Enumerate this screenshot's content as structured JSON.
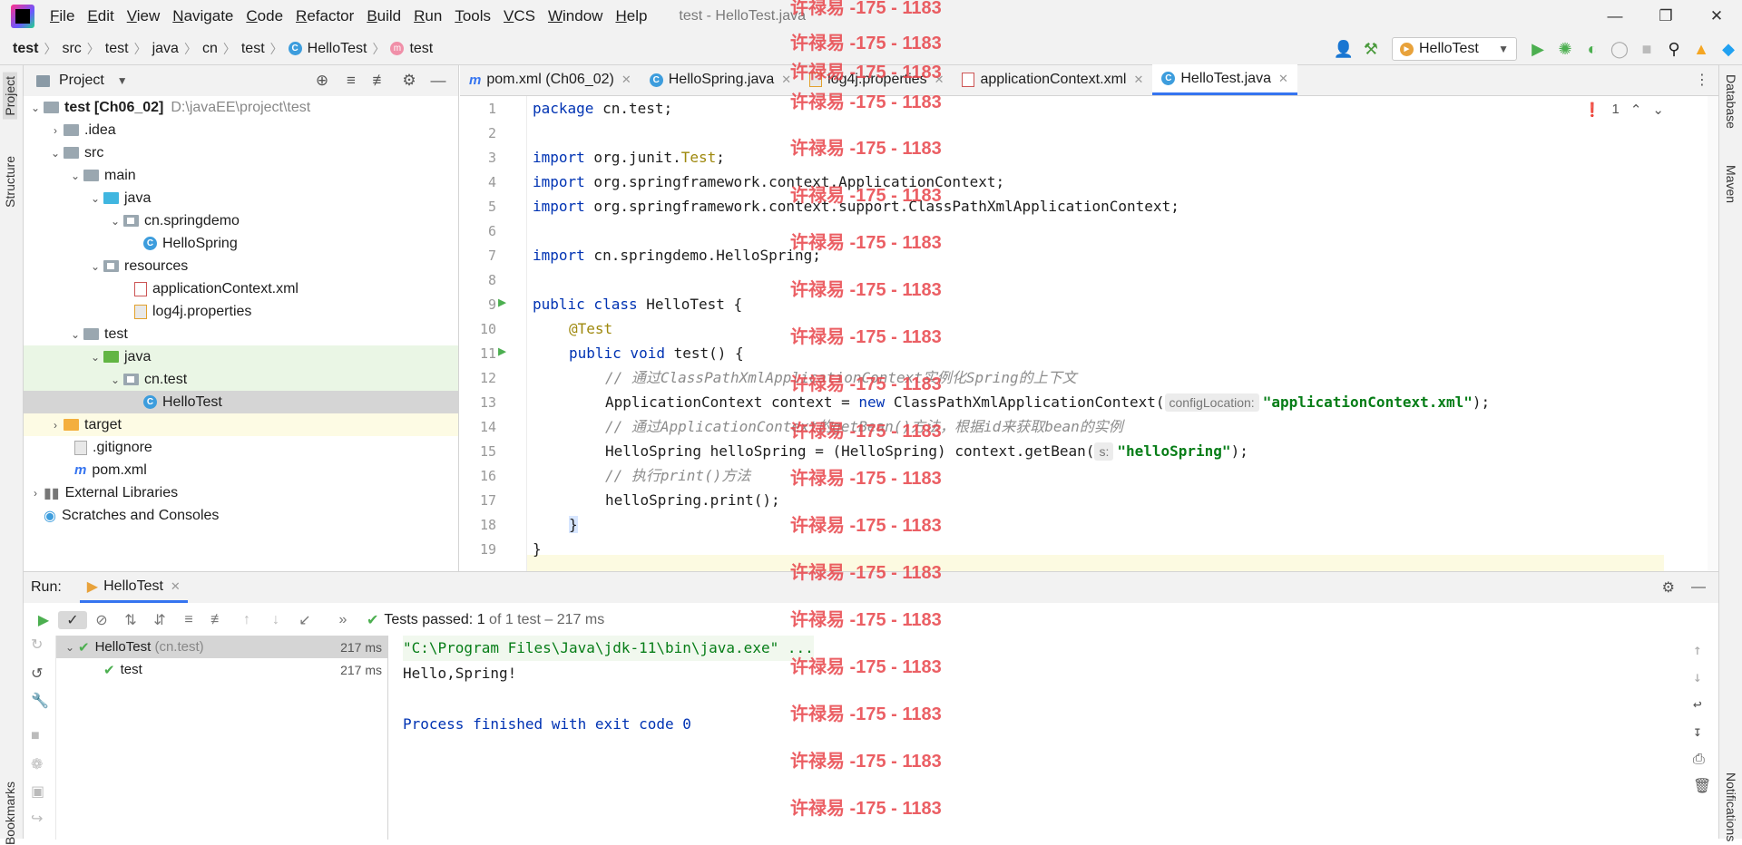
{
  "menubar": {
    "items": [
      "File",
      "Edit",
      "View",
      "Navigate",
      "Code",
      "Refactor",
      "Build",
      "Run",
      "Tools",
      "VCS",
      "Window",
      "Help"
    ],
    "window_title": "test - HelloTest.java"
  },
  "breadcrumb": {
    "items": [
      "test",
      "src",
      "test",
      "java",
      "cn",
      "test",
      "HelloTest",
      "test"
    ]
  },
  "toolbar": {
    "run_config": "HelloTest"
  },
  "side_tabs": {
    "left": [
      "Project",
      "Structure",
      "Bookmarks"
    ],
    "right": [
      "Database",
      "Maven",
      "Notifications"
    ]
  },
  "project": {
    "title": "Project",
    "tree": [
      {
        "label": "test [Ch06_02]",
        "path": "D:\\javaEE\\project\\test"
      },
      {
        "label": ".idea"
      },
      {
        "label": "src"
      },
      {
        "label": "main"
      },
      {
        "label": "java"
      },
      {
        "label": "cn.springdemo"
      },
      {
        "label": "HelloSpring"
      },
      {
        "label": "resources"
      },
      {
        "label": "applicationContext.xml"
      },
      {
        "label": "log4j.properties"
      },
      {
        "label": "test"
      },
      {
        "label": "java"
      },
      {
        "label": "cn.test"
      },
      {
        "label": "HelloTest"
      },
      {
        "label": "target"
      },
      {
        "label": ".gitignore"
      },
      {
        "label": "pom.xml"
      },
      {
        "label": "External Libraries"
      },
      {
        "label": "Scratches and Consoles"
      }
    ]
  },
  "editor": {
    "tabs": [
      "pom.xml (Ch06_02)",
      "HelloSpring.java",
      "log4j.properties",
      "applicationContext.xml",
      "HelloTest.java"
    ],
    "error_count": "1",
    "line_numbers": [
      "1",
      "2",
      "3",
      "4",
      "5",
      "6",
      "7",
      "8",
      "9",
      "10",
      "11",
      "12",
      "13",
      "14",
      "15",
      "16",
      "17",
      "18",
      "19"
    ],
    "code": {
      "l1_kw": "package",
      "l1_rest": " cn.test;",
      "l3_kw": "import",
      "l3_a": " org.junit.",
      "l3_b": "Test",
      "l3_c": ";",
      "l4_kw": "import",
      "l4_rest": " org.springframework.context.ApplicationContext;",
      "l5_kw": "import",
      "l5_rest": " org.springframework.context.support.ClassPathXmlApplicationContext;",
      "l7_kw": "import",
      "l7_rest": " cn.springdemo.HelloSpring;",
      "l9_kw": "public class",
      "l9_rest": " HelloTest {",
      "l10": "@Test",
      "l11_kw": "public void",
      "l11_rest": " test() {",
      "l12": "// 通过ClassPathXmlApplicationContext实例化Spring的上下文",
      "l13_a": "ApplicationContext context = ",
      "l13_kw": "new",
      "l13_b": " ClassPathXmlApplicationContext(",
      "l13_hint": "configLocation:",
      "l13_str": "\"applicationContext.xml\"",
      "l13_c": ");",
      "l14": "// 通过ApplicationContext的getBean()方法，根据id来获取bean的实例",
      "l15_a": "HelloSpring helloSpring = (HelloSpring) context.getBean(",
      "l15_hint": "s:",
      "l15_str": "\"helloSpring\"",
      "l15_c": ");",
      "l16": "// 执行print()方法",
      "l17": "helloSpring.print();",
      "l18": "}",
      "l19": "}"
    }
  },
  "run": {
    "label": "Run:",
    "tab": "HelloTest",
    "status_prefix": "Tests passed:",
    "status_count": "1",
    "status_suffix": "of 1 test – 217 ms",
    "tests": [
      {
        "name": "HelloTest",
        "detail": "(cn.test)",
        "time": "217 ms"
      },
      {
        "name": "test",
        "time": "217 ms"
      }
    ],
    "console": [
      "\"C:\\Program Files\\Java\\jdk-11\\bin\\java.exe\" ...",
      "Hello,Spring!",
      "",
      "Process finished with exit code 0"
    ]
  },
  "watermark": "许禄易 -175 - 1183",
  "colors": {
    "accent": "#3574f0",
    "keyword": "#0033b3",
    "string": "#067d17",
    "annotation": "#9e880d",
    "watermark": "#e8444a"
  }
}
